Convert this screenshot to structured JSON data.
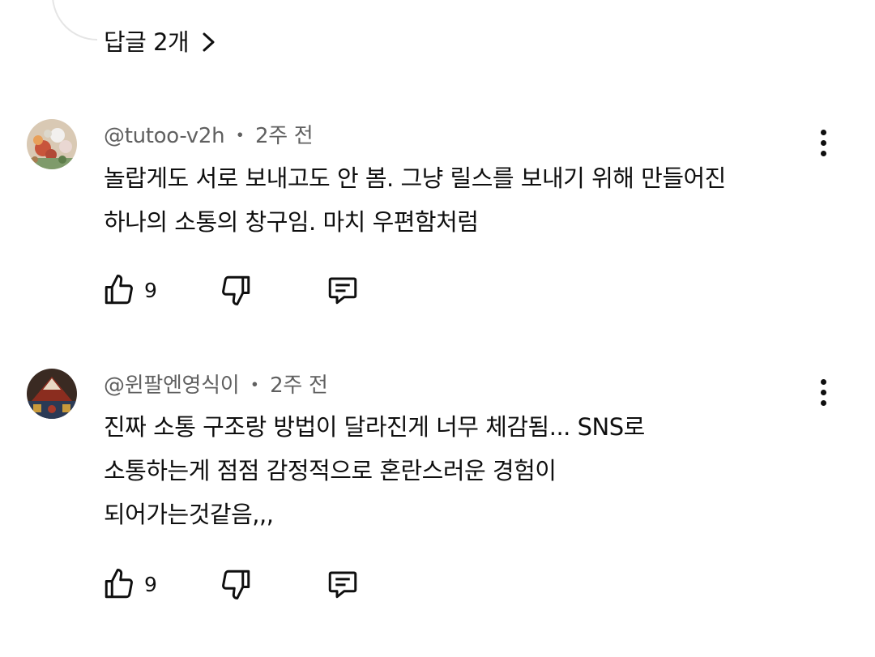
{
  "replies": {
    "label": "답글 2개"
  },
  "comments": [
    {
      "author": "@tutoo-v2h",
      "separator": "・",
      "time": "2주 전",
      "lines": [
        "놀랍게도 서로 보내고도 안 봄. 그냥 릴스를 보내기 위해 만들어진",
        "하나의 소통의 창구임. 마치 우편함처럼"
      ],
      "likes": "9"
    },
    {
      "author": "@윈팔엔영식이",
      "separator": "・",
      "time": "2주 전",
      "lines": [
        "진짜 소통 구조랑 방법이 달라진게 너무 체감됨... SNS로",
        "소통하는게 점점 감정적으로 혼란스러운 경험이",
        "되어가는것같음,,,"
      ],
      "likes": "9"
    }
  ],
  "icons": {
    "like": "thumbs-up-icon",
    "dislike": "thumbs-down-icon",
    "reply": "comment-icon",
    "menu": "more-vertical-icon",
    "expand": "chevron-right-icon"
  },
  "colors": {
    "text": "#0f0f0f",
    "meta": "#606060",
    "thread_line": "#e5e5e5"
  }
}
